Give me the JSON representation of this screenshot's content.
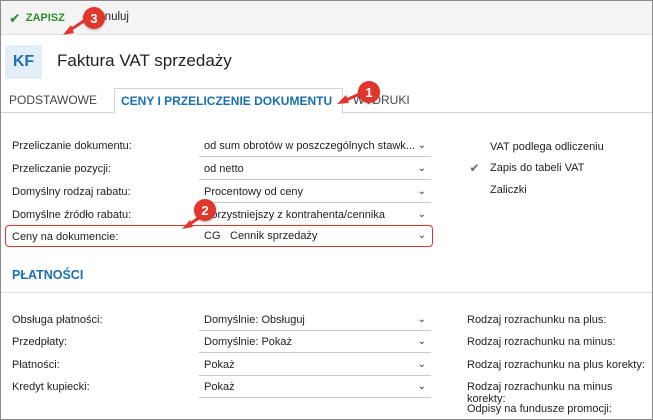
{
  "toolbar": {
    "save_label": "ZAPISZ",
    "save_icon": "✔",
    "cancel_label": "Anuluj"
  },
  "header": {
    "logo": "KF",
    "title": "Faktura VAT sprzedaży"
  },
  "tabs": [
    {
      "label": "PODSTAWOWE"
    },
    {
      "label": "CENY I PRZELICZENIE DOKUMENTU"
    },
    {
      "label": "WYDRUKI"
    }
  ],
  "form": {
    "rows": [
      {
        "label": "Przeliczanie dokumentu:",
        "value": "od sum obrotów w poszczególnych stawk..."
      },
      {
        "label": "Przeliczanie pozycji:",
        "value": "od netto"
      },
      {
        "label": "Domyślny rodzaj rabatu:",
        "value": "Procentowy od ceny"
      },
      {
        "label": "Domyślne źródło rabatu:",
        "value": "Korzystniejszy z kontrahenta/cennika"
      },
      {
        "label": "Ceny na dokumencie:",
        "code": "CG",
        "value": "Cennik sprzedaży"
      }
    ],
    "checkboxes": [
      {
        "label": "VAT podlega odliczeniu",
        "checked": false
      },
      {
        "label": "Zapis do tabeli VAT",
        "checked": true
      },
      {
        "label": "Zaliczki",
        "checked": false
      }
    ]
  },
  "payments": {
    "title": "PŁATNOŚCI",
    "rows": [
      {
        "label": "Obsługa płatności:",
        "value": "Domyślnie: Obsługuj"
      },
      {
        "label": "Przedpłaty:",
        "value": "Domyślnie: Pokaż"
      },
      {
        "label": "Płatności:",
        "value": "Pokaż"
      },
      {
        "label": "Kredyt kupiecki:",
        "value": "Pokaż"
      }
    ],
    "right_labels": [
      "Rodzaj rozrachunku na plus:",
      "Rodzaj rozrachunku na minus:",
      "Rodzaj rozrachunku na plus korekty:",
      "Rodzaj rozrachunku na minus korekty:",
      "Odpisy na fundusze promocji:"
    ]
  },
  "callouts": [
    "1",
    "2",
    "3"
  ],
  "colors": {
    "accent": "#1a6fb0",
    "save_green": "#2e8b2e",
    "callout_red": "#e0362c"
  }
}
